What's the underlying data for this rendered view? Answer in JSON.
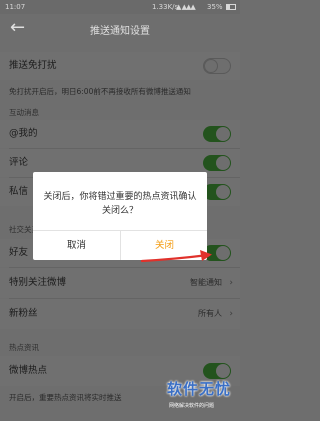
{
  "status_bar": {
    "time": "11:07",
    "network_speed": "1.33K/s",
    "signal": "▲ ▲▲▲",
    "battery": "35%"
  },
  "header": {
    "back_glyph": "←",
    "title": "推送通知设置"
  },
  "dnd": {
    "label": "推送免打扰",
    "enabled": false,
    "note": "免打扰开启后，明日6:00前不再接收所有微博推送通知"
  },
  "interaction": {
    "section_title": "互动消息",
    "items": [
      {
        "label": "@我的",
        "enabled": true
      },
      {
        "label": "评论",
        "enabled": true
      },
      {
        "label": "私信",
        "enabled": true
      }
    ]
  },
  "social": {
    "section_title": "社交关系",
    "items": [
      {
        "label": "好友",
        "enabled": true
      },
      {
        "label": "特别关注微博",
        "value": "智能通知",
        "chevron": "›"
      },
      {
        "label": "新粉丝",
        "value": "所有人",
        "chevron": "›"
      }
    ]
  },
  "hot": {
    "section_title": "热点资讯",
    "items": [
      {
        "label": "微博热点",
        "enabled": true
      }
    ],
    "note": "开启后，重要热点资讯将实时推送"
  },
  "dialog": {
    "message": "关闭后，你将错过重要的热点资讯确认关闭么？",
    "cancel_label": "取消",
    "confirm_label": "关闭"
  },
  "watermark": {
    "title": "软件无忧",
    "subtitle": "网络解决软件的问题"
  },
  "colors": {
    "accent": "#f39c12",
    "toggle_on": "#23531d",
    "overlay": "#6e6e6e",
    "arrow": "#e0312b"
  }
}
